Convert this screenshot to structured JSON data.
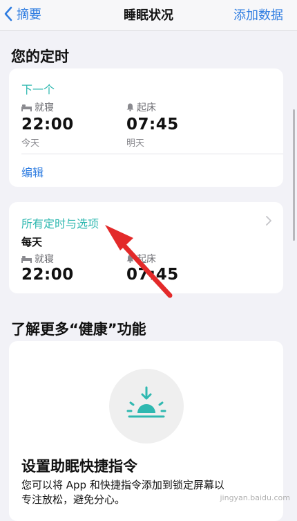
{
  "nav": {
    "back_label": "摘要",
    "title": "睡眠状况",
    "action_label": "添加数据"
  },
  "schedule": {
    "section_title": "您的定时",
    "next_label": "下一个",
    "bedtime_label": "就寝",
    "bedtime_value": "22:00",
    "bedtime_day": "今天",
    "wake_label": "起床",
    "wake_value": "07:45",
    "wake_day": "明天",
    "edit_label": "编辑"
  },
  "all_schedules": {
    "title": "所有定时与选项",
    "frequency": "每天",
    "bedtime_label": "就寝",
    "bedtime_value": "22:00",
    "wake_label": "起床",
    "wake_value": "07:45"
  },
  "learn_more": {
    "section_title": "了解更多“健康”功能",
    "shortcut_title": "设置助眠快捷指令",
    "shortcut_desc_line1": "您可以将 App 和快捷指令添加到锁定屏幕以",
    "shortcut_desc_line2": "专注放松，避免分心。"
  },
  "watermark": "jingyan.baidu.com",
  "colors": {
    "accent_teal": "#2fb8b0",
    "link_blue": "#2f7de1",
    "arrow_red": "#e32a2a"
  },
  "icons": [
    "chevron-left-icon",
    "bed-icon",
    "bell-icon",
    "chevron-right-icon",
    "sunset-icon",
    "red-arrow-annotation"
  ]
}
